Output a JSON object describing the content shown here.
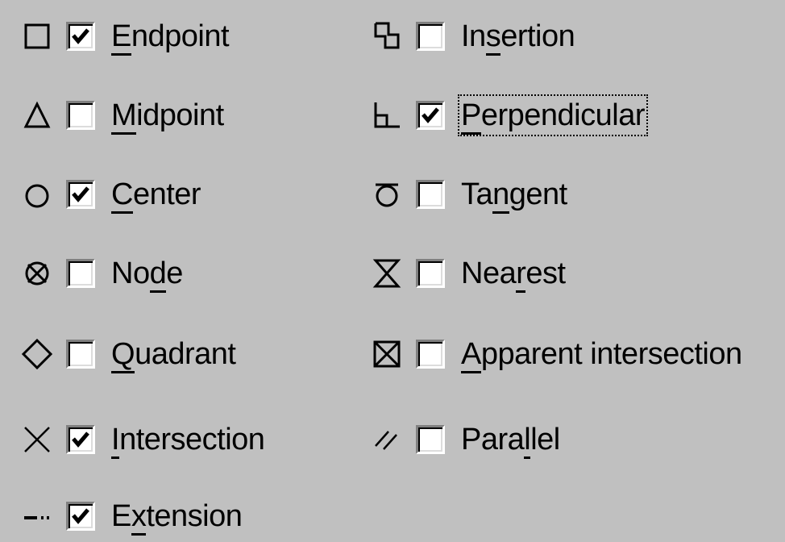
{
  "osnap_modes": {
    "left": [
      {
        "id": "endpoint",
        "prefix": "",
        "mnemonic": "E",
        "suffix": "ndpoint",
        "checked": true,
        "marker": "square-icon"
      },
      {
        "id": "midpoint",
        "prefix": "",
        "mnemonic": "M",
        "suffix": "idpoint",
        "checked": false,
        "marker": "triangle-icon"
      },
      {
        "id": "center",
        "prefix": "",
        "mnemonic": "C",
        "suffix": "enter",
        "checked": true,
        "marker": "circle-icon"
      },
      {
        "id": "node",
        "prefix": "No",
        "mnemonic": "d",
        "suffix": "e",
        "checked": false,
        "marker": "node-icon"
      },
      {
        "id": "quadrant",
        "prefix": "",
        "mnemonic": "Q",
        "suffix": "uadrant",
        "checked": false,
        "marker": "diamond-icon"
      },
      {
        "id": "intersection",
        "prefix": "",
        "mnemonic": "I",
        "suffix": "ntersection",
        "checked": true,
        "marker": "x-icon"
      },
      {
        "id": "extension",
        "prefix": "E",
        "mnemonic": "x",
        "suffix": "tension",
        "checked": true,
        "marker": "extension-icon"
      }
    ],
    "right": [
      {
        "id": "insertion",
        "prefix": "In",
        "mnemonic": "s",
        "suffix": "ertion",
        "checked": false,
        "marker": "insertion-icon"
      },
      {
        "id": "perpendicular",
        "prefix": "",
        "mnemonic": "P",
        "suffix": "erpendicular",
        "checked": true,
        "marker": "perpendicular-icon",
        "focused": true
      },
      {
        "id": "tangent",
        "prefix": "Ta",
        "mnemonic": "n",
        "suffix": "gent",
        "checked": false,
        "marker": "tangent-icon"
      },
      {
        "id": "nearest",
        "prefix": "Nea",
        "mnemonic": "r",
        "suffix": "est",
        "checked": false,
        "marker": "nearest-icon"
      },
      {
        "id": "apparent_intersection",
        "prefix": "",
        "mnemonic": "A",
        "suffix": "pparent intersection",
        "checked": false,
        "marker": "apparent-intersection-icon"
      },
      {
        "id": "parallel",
        "prefix": "Para",
        "mnemonic": "l",
        "suffix": "lel",
        "checked": false,
        "marker": "parallel-icon"
      }
    ]
  }
}
